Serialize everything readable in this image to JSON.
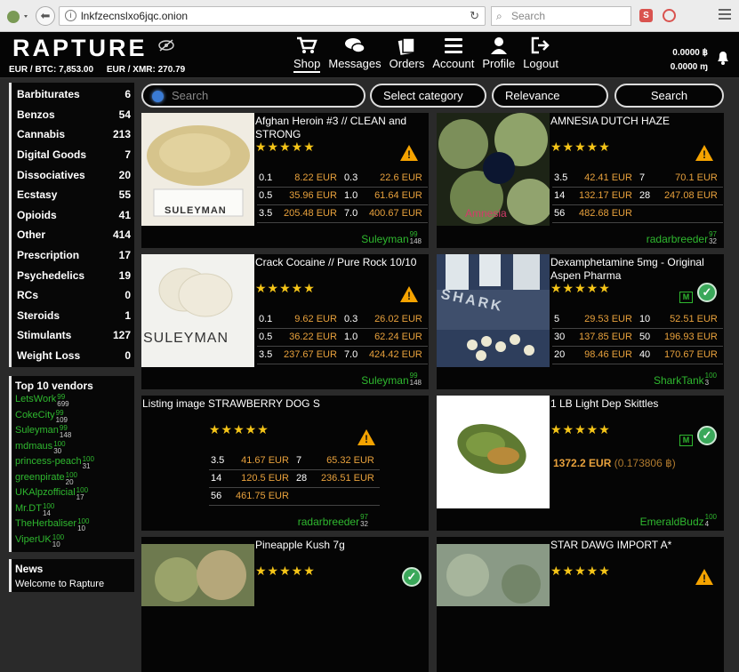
{
  "browser": {
    "url": "lnkfzecnslxo6jqc.onion",
    "search_placeholder": "Search"
  },
  "header": {
    "logo": "RAPTURE",
    "rate_btc": "EUR / BTC: 7,853.00",
    "rate_xmr": "EUR / XMR: 270.79",
    "nav": [
      {
        "label": "Shop",
        "icon": "cart-icon"
      },
      {
        "label": "Messages",
        "icon": "chat-icon"
      },
      {
        "label": "Orders",
        "icon": "orders-icon"
      },
      {
        "label": "Account",
        "icon": "menu-lines-icon"
      },
      {
        "label": "Profile",
        "icon": "user-icon"
      },
      {
        "label": "Logout",
        "icon": "logout-icon"
      }
    ],
    "balance_btc": "0.0000 ฿",
    "balance_xmr": "0.0000 ɱ"
  },
  "categories": [
    {
      "name": "Barbiturates",
      "count": "6"
    },
    {
      "name": "Benzos",
      "count": "54"
    },
    {
      "name": "Cannabis",
      "count": "213"
    },
    {
      "name": "Digital Goods",
      "count": "7"
    },
    {
      "name": "Dissociatives",
      "count": "20"
    },
    {
      "name": "Ecstasy",
      "count": "55"
    },
    {
      "name": "Opioids",
      "count": "41"
    },
    {
      "name": "Other",
      "count": "414"
    },
    {
      "name": "Prescription",
      "count": "17"
    },
    {
      "name": "Psychedelics",
      "count": "19"
    },
    {
      "name": "RCs",
      "count": "0"
    },
    {
      "name": "Steroids",
      "count": "1"
    },
    {
      "name": "Stimulants",
      "count": "127"
    },
    {
      "name": "Weight Loss",
      "count": "0"
    }
  ],
  "top_vendors": {
    "title": "Top 10 vendors",
    "items": [
      {
        "name": "LetsWork",
        "r1": "99",
        "r2": "699"
      },
      {
        "name": "CokeCity",
        "r1": "99",
        "r2": "109"
      },
      {
        "name": "Suleyman",
        "r1": "99",
        "r2": "148"
      },
      {
        "name": "mdmaus",
        "r1": "100",
        "r2": "30"
      },
      {
        "name": "princess-peach",
        "r1": "100",
        "r2": "31"
      },
      {
        "name": "greenpirate",
        "r1": "100",
        "r2": "20"
      },
      {
        "name": "UKAlpzofficial",
        "r1": "100",
        "r2": "17"
      },
      {
        "name": "Mr.DT",
        "r1": "100",
        "r2": "14"
      },
      {
        "name": "TheHerbaliser",
        "r1": "100",
        "r2": "10"
      },
      {
        "name": "ViperUK",
        "r1": "100",
        "r2": "10"
      }
    ]
  },
  "news": {
    "title": "News",
    "text": "Welcome to Rapture"
  },
  "toolbar": {
    "search_placeholder": "Search",
    "category": "Select category",
    "sort": "Relevance",
    "search_button": "Search"
  },
  "listings": [
    {
      "title": "Afghan Heroin #3 // CLEAN and STRONG",
      "image_text": "SULEYMAN",
      "rows": [
        [
          "0.1",
          "8.22 EUR",
          "0.3",
          "22.6 EUR"
        ],
        [
          "0.5",
          "35.96 EUR",
          "1.0",
          "61.64 EUR"
        ],
        [
          "3.5",
          "205.48 EUR",
          "7.0",
          "400.67 EUR"
        ]
      ],
      "vendor": "Suleyman",
      "r1": "99",
      "r2": "148"
    },
    {
      "title": "AMNESIA DUTCH HAZE",
      "image_text": "Amnesia",
      "rows": [
        [
          "3.5",
          "42.41 EUR",
          "7",
          "70.1 EUR"
        ],
        [
          "14",
          "132.17 EUR",
          "28",
          "247.08 EUR"
        ],
        [
          "56",
          "482.68 EUR",
          "",
          ""
        ]
      ],
      "vendor": "radarbreeder",
      "r1": "97",
      "r2": "32"
    },
    {
      "title": "Crack Cocaine // Pure Rock 10/10",
      "image_text": "SULEYMAN",
      "rows": [
        [
          "0.1",
          "9.62 EUR",
          "0.3",
          "26.02 EUR"
        ],
        [
          "0.5",
          "36.22 EUR",
          "1.0",
          "62.24 EUR"
        ],
        [
          "3.5",
          "237.67 EUR",
          "7.0",
          "424.42 EUR"
        ]
      ],
      "vendor": "Suleyman",
      "r1": "99",
      "r2": "148"
    },
    {
      "title": "Dexamphetamine 5mg - Original Aspen Pharma",
      "image_text": "SHARK",
      "rows": [
        [
          "5",
          "29.53 EUR",
          "10",
          "52.51 EUR"
        ],
        [
          "30",
          "137.85 EUR",
          "50",
          "196.93 EUR"
        ],
        [
          "20",
          "98.46 EUR",
          "40",
          "170.67 EUR"
        ]
      ],
      "vendor": "SharkTank",
      "r1": "100",
      "r2": "3"
    },
    {
      "title": "Listing image STRAWBERRY DOG S",
      "rows": [
        [
          "3.5",
          "41.67 EUR",
          "7",
          "65.32 EUR"
        ],
        [
          "14",
          "120.5 EUR",
          "28",
          "236.51 EUR"
        ],
        [
          "56",
          "461.75 EUR",
          "",
          ""
        ]
      ],
      "vendor": "radarbreeder",
      "r1": "97",
      "r2": "32"
    },
    {
      "title": "1 LB Light Dep Skittles",
      "price": "1372.2 EUR",
      "price_btc": "(0.173806 ฿)",
      "vendor": "EmeraldBudz",
      "r1": "100",
      "r2": "4"
    },
    {
      "title": "Pineapple Kush 7g"
    },
    {
      "title": "STAR DAWG IMPORT A*"
    }
  ],
  "labels": {
    "warning": "!",
    "check": "✓",
    "m_badge": "M",
    "stars": "★★★★★"
  }
}
